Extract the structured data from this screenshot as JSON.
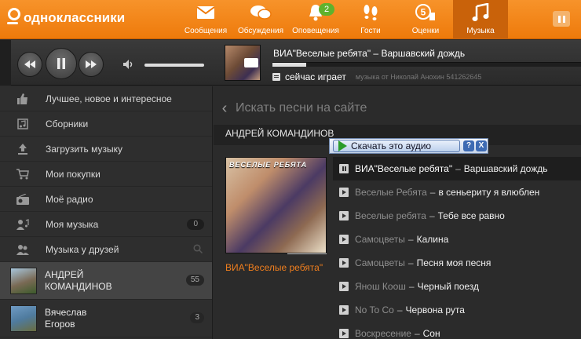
{
  "header": {
    "logo_text": "одноклассники",
    "nav": [
      {
        "label": "Сообщения",
        "icon": "envelope-icon"
      },
      {
        "label": "Обсуждения",
        "icon": "chat-bubbles-icon"
      },
      {
        "label": "Оповещения",
        "icon": "bell-icon",
        "badge": "2"
      },
      {
        "label": "Гости",
        "icon": "footprints-icon"
      },
      {
        "label": "Оценки",
        "icon": "rating-5-icon"
      },
      {
        "label": "Музыка",
        "icon": "music-note-icon",
        "active": true
      }
    ],
    "brand_color": "#f28a1c"
  },
  "player": {
    "track_title": "ВИА\"Веселые ребята\" – Варшавский дождь",
    "status": "сейчас играет",
    "sub_text": "музыка от Николай Анохин 541262645",
    "progress": 0.11
  },
  "sidebar": {
    "menu": [
      {
        "label": "Лучшее, новое и интересное",
        "icon": "thumbs-up-icon"
      },
      {
        "label": "Сборники",
        "icon": "collection-icon"
      },
      {
        "label": "Загрузить музыку",
        "icon": "upload-icon"
      },
      {
        "label": "Мои покупки",
        "icon": "cart-icon"
      },
      {
        "label": "Моё радио",
        "icon": "radio-icon"
      },
      {
        "label": "Моя музыка",
        "icon": "my-music-icon",
        "count": "0"
      },
      {
        "label": "Музыка у друзей",
        "icon": "friends-icon"
      }
    ],
    "friends": [
      {
        "name_line1": "АНДРЕЙ",
        "name_line2": "КОМАНДИНОВ",
        "count": "55",
        "active": true
      },
      {
        "name_line1": "Вячеслав",
        "name_line2": "Егоров",
        "count": "3"
      }
    ]
  },
  "main": {
    "search_placeholder": "Искать песни на сайте",
    "artist_header": "АНДРЕЙ КОМАНДИНОВ",
    "album_caption": "ВИА\"Веселые ребята\"",
    "album_art_text": "ВЕСЕЛЫЕ РЕБЯТА",
    "tracks": [
      {
        "artist": "ВИА\"Веселые ребята\"",
        "song": "Варшавский дождь",
        "playing": true
      },
      {
        "artist": "Веселые Ребята",
        "song": "в сеньериту я влюблен"
      },
      {
        "artist": "Веселые ребята",
        "song": "Тебе все равно"
      },
      {
        "artist": "Самоцветы",
        "song": "Калина"
      },
      {
        "artist": "Самоцветы",
        "song": "Песня моя песня"
      },
      {
        "artist": "Янош Коош",
        "song": "Черный поезд"
      },
      {
        "artist": "No To Co",
        "song": "Червона рута"
      },
      {
        "artist": "Воскресение",
        "song": "Сон"
      }
    ]
  },
  "download_bar": {
    "label": "Скачать это аудио",
    "help": "?",
    "close": "X"
  }
}
